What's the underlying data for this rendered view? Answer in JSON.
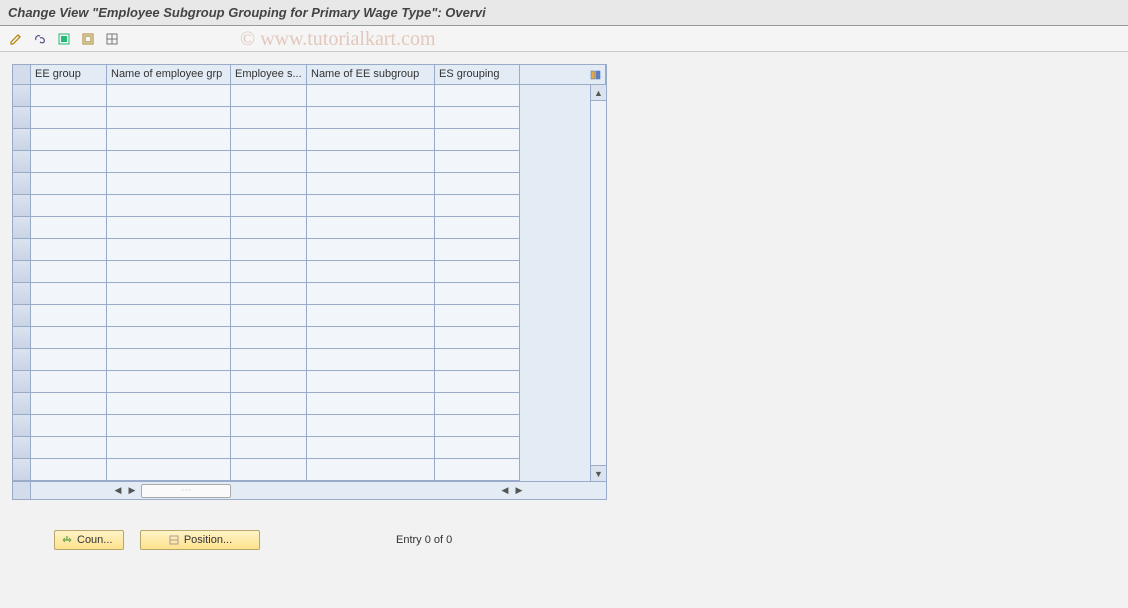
{
  "title": "Change View \"Employee Subgroup Grouping for Primary Wage Type\": Overvi",
  "watermark": "© www.tutorialkart.com",
  "columns": {
    "c1": "EE group",
    "c2": "Name of employee grp",
    "c3": "Employee s...",
    "c4": "Name of EE subgroup",
    "c5": "ES grouping"
  },
  "footer": {
    "countries_btn": "Coun...",
    "position_btn": "Position...",
    "entry_status": "Entry 0 of 0"
  }
}
